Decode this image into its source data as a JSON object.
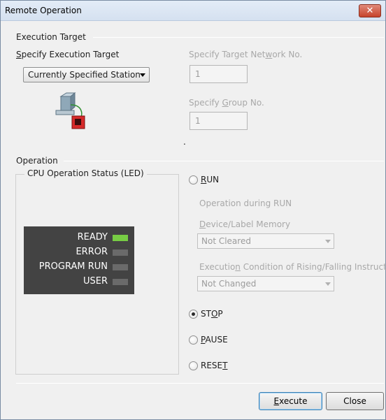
{
  "window": {
    "title": "Remote Operation",
    "close_glyph": "✕"
  },
  "execution_target": {
    "section_title": "Execution Target",
    "specify_label_pre": "",
    "specify_label_u": "S",
    "specify_label_post": "pecify Execution Target",
    "dropdown_value": "Currently Specified Station",
    "network_label_pre": "Specify Target Net",
    "network_label_u": "w",
    "network_label_post": "ork No.",
    "network_value": "1",
    "group_label_pre": "Specify ",
    "group_label_u": "G",
    "group_label_post": "roup No.",
    "group_value": "1",
    "dot": "."
  },
  "operation": {
    "section_title": "Operation",
    "led_group_title": "CPU Operation Status (LED)",
    "leds": [
      {
        "label": "READY",
        "on": true
      },
      {
        "label": "ERROR",
        "on": false
      },
      {
        "label": "PROGRAM RUN",
        "on": false
      },
      {
        "label": "USER",
        "on": false
      }
    ],
    "run": {
      "u": "R",
      "rest": "UN",
      "checked": false
    },
    "operation_during_run": "Operation during RUN",
    "device_label_u": "D",
    "device_label_rest": "evice/Label Memory",
    "device_value": "Not Cleared",
    "exec_cond_pre": "Executio",
    "exec_cond_u": "n",
    "exec_cond_post": " Condition of Rising/Falling Instruction",
    "exec_cond_value": "Not Changed",
    "stop": {
      "pre": "ST",
      "u": "O",
      "post": "P",
      "checked": true
    },
    "pause": {
      "u": "P",
      "rest": "AUSE",
      "checked": false
    },
    "reset": {
      "pre": "RESE",
      "u": "T",
      "checked": false
    }
  },
  "buttons": {
    "execute_u": "E",
    "execute_rest": "xecute",
    "close": "Close"
  },
  "colors": {
    "led_on": "#77cc44",
    "led_off": "#6a6a6a",
    "led_panel": "#434343"
  }
}
